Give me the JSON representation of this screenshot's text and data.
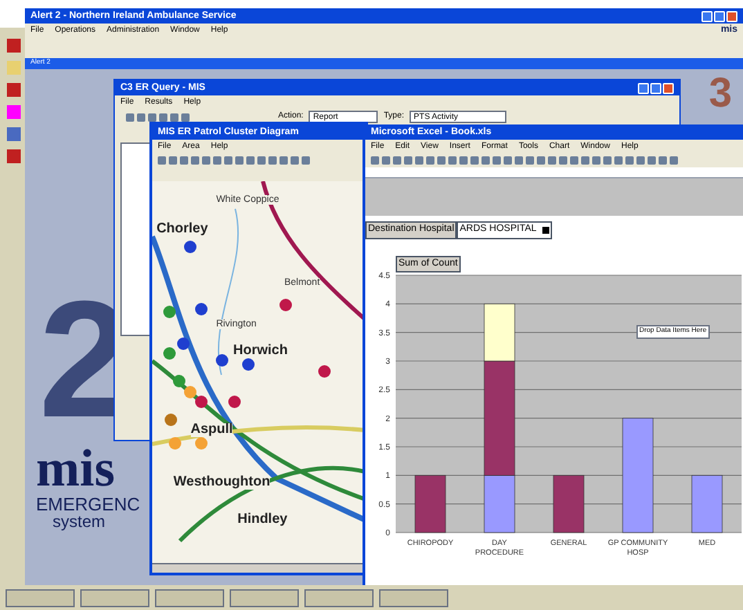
{
  "main_window": {
    "title": "Alert 2 - Northern Ireland Ambulance Service",
    "menu": [
      "File",
      "Operations",
      "Administration",
      "Window",
      "Help"
    ],
    "brand": "mis",
    "inner_title": "Alert 2"
  },
  "logo": {
    "big_numbers": [
      "2",
      "3"
    ],
    "word": "mis",
    "line1": "EMERGENC",
    "line2": "system"
  },
  "query_window": {
    "title": "C3 ER Query - MIS",
    "menu": [
      "File",
      "Results",
      "Help"
    ],
    "action_label": "Action:",
    "action_value": "Report",
    "type_label": "Type:",
    "type_value": "PTS Activity"
  },
  "map_window": {
    "title": "MIS ER Patrol Cluster Diagram",
    "menu": [
      "File",
      "Area",
      "Help"
    ],
    "places": [
      {
        "name": "White Coppice"
      },
      {
        "name": "Chorley",
        "kind": "town"
      },
      {
        "name": "Belmont"
      },
      {
        "name": "Rivington"
      },
      {
        "name": "Horwich",
        "kind": "town"
      },
      {
        "name": "Aspull",
        "kind": "town"
      },
      {
        "name": "Westhoughton",
        "kind": "town"
      },
      {
        "name": "Hindley",
        "kind": "town"
      }
    ],
    "markers": [
      {
        "color": "#1f3fcf"
      },
      {
        "color": "#1f3fcf"
      },
      {
        "color": "#1f3fcf"
      },
      {
        "color": "#1f3fcf"
      },
      {
        "color": "#1f3fcf"
      },
      {
        "color": "#c0184a"
      },
      {
        "color": "#c0184a"
      },
      {
        "color": "#c0184a"
      },
      {
        "color": "#c0184a"
      },
      {
        "color": "#2e9a3a"
      },
      {
        "color": "#2e9a3a"
      },
      {
        "color": "#2e9a3a"
      },
      {
        "color": "#f4a235"
      },
      {
        "color": "#f4a235"
      },
      {
        "color": "#f4a235"
      },
      {
        "color": "#b8741a"
      }
    ]
  },
  "excel_window": {
    "title": "Microsoft Excel - Book.xls",
    "menu": [
      "File",
      "Edit",
      "View",
      "Insert",
      "Format",
      "Tools",
      "Chart",
      "Window",
      "Help"
    ],
    "page_field": "Destination Hospital",
    "page_value": "ARDS HOSPITAL",
    "data_field": "Sum of Count",
    "drop_hint": "Drop Data Items Here",
    "chart_data": {
      "type": "bar",
      "stacked": true,
      "grid": true,
      "categories": [
        "CHIROPODY",
        "DAY PROCEDURE",
        "GENERAL",
        "GP COMMUNITY HOSP",
        "MED"
      ],
      "ylim": [
        0,
        4.5
      ],
      "yticks": [
        0,
        0.5,
        1,
        1.5,
        2,
        2.5,
        3,
        3.5,
        4,
        4.5
      ],
      "series": [
        {
          "color": "#9999ff",
          "values": [
            0,
            1,
            0,
            2,
            1
          ]
        },
        {
          "color": "#993366",
          "values": [
            1,
            2,
            1,
            0,
            0
          ]
        },
        {
          "color": "#ffffcc",
          "values": [
            0,
            1,
            0,
            0,
            0
          ]
        }
      ]
    }
  }
}
